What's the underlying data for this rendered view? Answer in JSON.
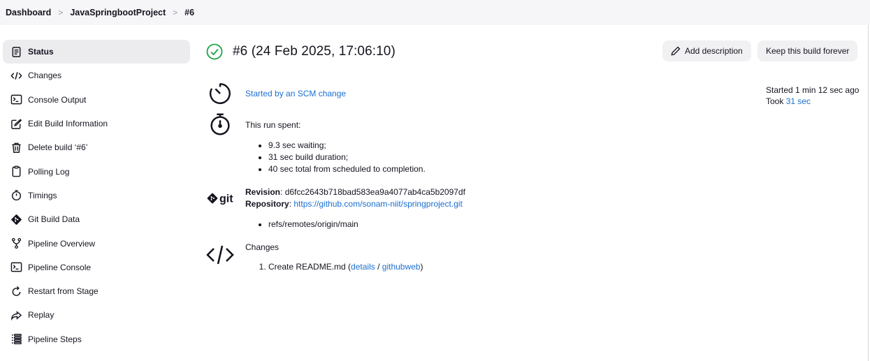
{
  "breadcrumb": {
    "items": [
      "Dashboard",
      "JavaSpringbootProject",
      "#6"
    ],
    "separator": ">"
  },
  "sidebar": {
    "items": [
      {
        "label": "Status",
        "icon": "document-icon",
        "active": true
      },
      {
        "label": "Changes",
        "icon": "code-icon"
      },
      {
        "label": "Console Output",
        "icon": "terminal-icon"
      },
      {
        "label": "Edit Build Information",
        "icon": "edit-icon"
      },
      {
        "label": "Delete build ‘#6’",
        "icon": "trash-icon"
      },
      {
        "label": "Polling Log",
        "icon": "clipboard-icon"
      },
      {
        "label": "Timings",
        "icon": "stopwatch-icon"
      },
      {
        "label": "Git Build Data",
        "icon": "git-icon"
      },
      {
        "label": "Pipeline Overview",
        "icon": "branch-icon"
      },
      {
        "label": "Pipeline Console",
        "icon": "terminal-icon"
      },
      {
        "label": "Restart from Stage",
        "icon": "restart-icon"
      },
      {
        "label": "Replay",
        "icon": "replay-icon"
      },
      {
        "label": "Pipeline Steps",
        "icon": "list-icon"
      }
    ]
  },
  "build": {
    "title": "#6 (24 Feb 2025, 17:06:10)",
    "add_description": "Add description",
    "keep_forever": "Keep this build forever",
    "started_by": "Started by an SCM change",
    "started_ago": "Started 1 min 12 sec ago",
    "took_prefix": "Took",
    "took_value": "31 sec",
    "run_spent_label": "This run spent:",
    "run_spent": [
      "9.3 sec waiting;",
      "31 sec build duration;",
      "40 sec total from scheduled to completion."
    ],
    "revision_label": "Revision",
    "revision_value": "d6fcc2643b718bad583ea9a4077ab4ca5b2097df",
    "repository_label": "Repository",
    "repository_url": "https://github.com/sonam-niit/springproject.git",
    "refs": [
      "refs/remotes/origin/main"
    ],
    "git_logo_text": "git",
    "changes_label": "Changes",
    "change_item": "Create README.md",
    "change_open": "(",
    "change_details": "details",
    "change_slash": "/",
    "change_githubweb": "githubweb",
    "change_close": ")"
  },
  "colors": {
    "link": "#1a6fd1",
    "success": "#1ea446",
    "active_bg": "#ececef"
  }
}
